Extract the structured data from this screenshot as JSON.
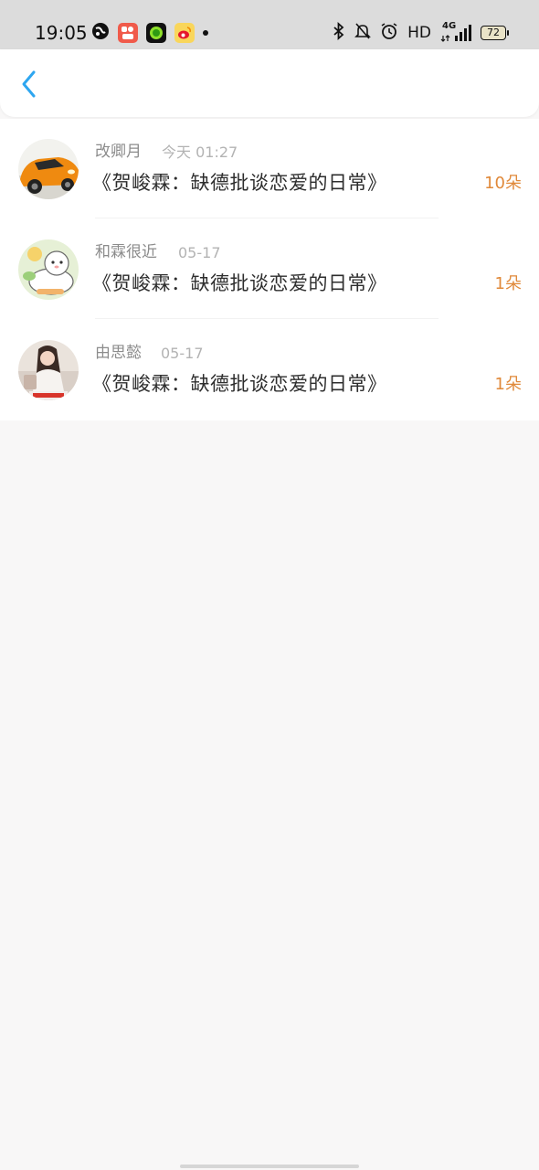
{
  "status_bar": {
    "time": "19:05",
    "hd": "HD",
    "network": "4G",
    "battery": "72",
    "left_icons": [
      "planet-icon",
      "kuaishou-icon",
      "green-circle-app-icon",
      "weibo-icon"
    ],
    "right_icons": [
      "bluetooth-icon",
      "mute-bell-icon",
      "alarm-icon",
      "signal-icon",
      "battery-icon"
    ]
  },
  "header": {
    "back_icon": "chevron-left-icon"
  },
  "colors": {
    "accent_back": "#2ea6f0",
    "count_orange": "#e0893a",
    "name_gray": "#8c8c8c",
    "time_gray": "#b3b3b3",
    "title_dark": "#2d2d2d",
    "page_bg": "#f8f7f7",
    "status_bg": "#dcdcdc"
  },
  "gifts": [
    {
      "name": "改卿月",
      "time": "今天 01:27",
      "title": "《贺峻霖：缺德批谈恋爱的日常》",
      "count": "10朵",
      "avatar": "orange-car-avatar"
    },
    {
      "name": "和霖很近",
      "time": "05-17",
      "title": "《贺峻霖：缺德批谈恋爱的日常》",
      "count": "1朵",
      "avatar": "cartoon-bear-avatar"
    },
    {
      "name": "由思懿",
      "time": "05-17",
      "title": "《贺峻霖：缺德批谈恋爱的日常》",
      "count": "1朵",
      "avatar": "girl-photo-avatar"
    }
  ]
}
